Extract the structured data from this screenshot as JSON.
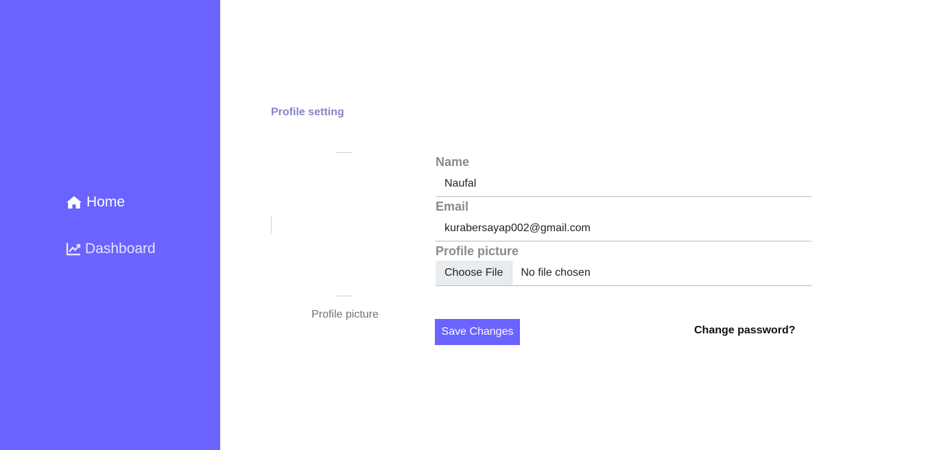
{
  "sidebar": {
    "items": [
      {
        "label": "Home",
        "icon": "home-icon"
      },
      {
        "label": "Dashboard",
        "icon": "chart-line-icon"
      }
    ],
    "background": "#6a63ff"
  },
  "main": {
    "section_title": "Profile setting",
    "avatar_caption": "Profile picture",
    "form": {
      "name_label": "Name",
      "name_value": "Naufal",
      "email_label": "Email",
      "email_value": "kurabersayap002@gmail.com",
      "picture_label": "Profile picture",
      "file_button": "Choose File",
      "file_status": "No file chosen"
    },
    "save_button": "Save Changes",
    "change_password_link": "Change password?"
  },
  "colors": {
    "accent": "#6a63ff",
    "section_title": "#8387c9",
    "label": "#8a8a8a"
  }
}
